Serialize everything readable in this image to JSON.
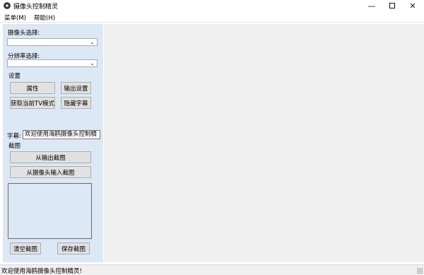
{
  "window": {
    "title": "摄像头控制精灵",
    "min_glyph": "—",
    "close_glyph": "✕"
  },
  "menubar": {
    "items": [
      "菜单(M)",
      "帮助(H)"
    ]
  },
  "left_panel": {
    "camera_select_label": "摄像头选择:",
    "camera_select_value": "",
    "resolution_select_label": "分辨率选择:",
    "resolution_select_value": "",
    "settings_label": "设置",
    "buttons": {
      "properties": "属性",
      "output_settings": "输出设置",
      "get_tv_mode": "获取当前TV模式",
      "hide_caption": "隐藏字幕"
    },
    "caption_label": "字幕:",
    "caption_value": "欢迎使用海鸥摄像头控制精",
    "screenshot_label": "截图",
    "capture_from_output": "从输出截图",
    "capture_from_camera": "从摄像头输入截图",
    "clear_screenshot": "清空截图",
    "save_screenshot": "保存截图"
  },
  "statusbar": {
    "text": "欢迎使用海鸥摄像头控制精灵!"
  },
  "colors": {
    "panel_bg": "#dce8f5",
    "main_bg": "#f0f0f0",
    "button_bg": "#e1e1e1"
  }
}
